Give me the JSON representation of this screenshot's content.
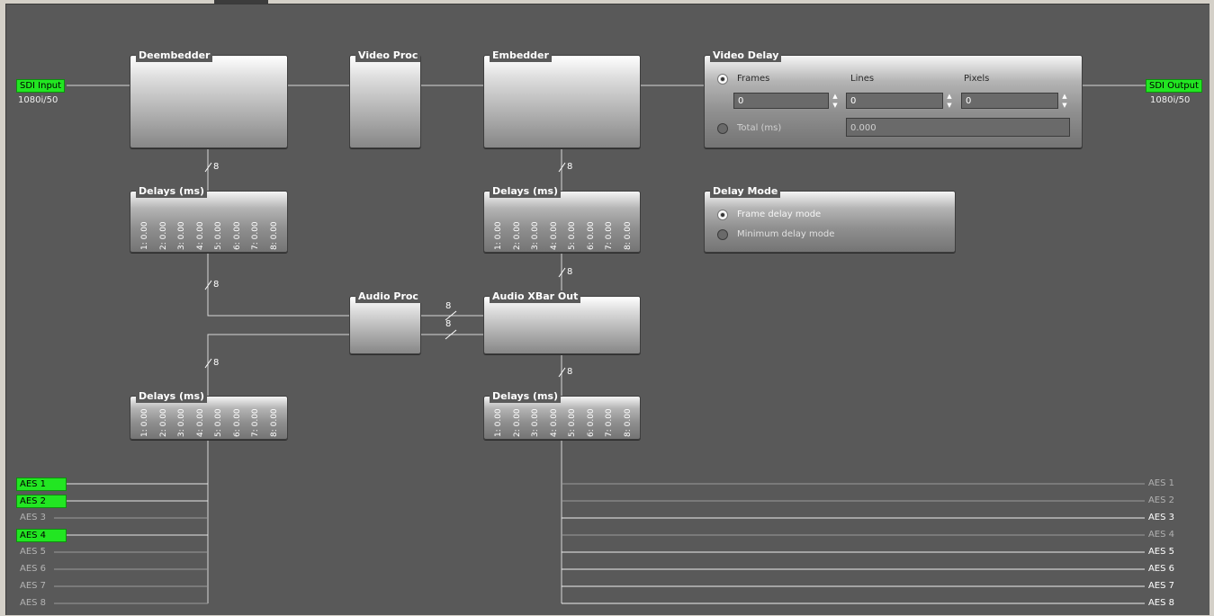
{
  "io": {
    "sdi_input_label": "SDI Input",
    "sdi_input_format": "1080i/50",
    "sdi_output_label": "SDI Output",
    "sdi_output_format": "1080i/50"
  },
  "blocks": {
    "deembedder": "Deembedder",
    "video_proc": "Video Proc",
    "embedder": "Embedder",
    "audio_proc": "Audio Proc",
    "audio_xbar_out": "Audio XBar Out"
  },
  "channel_count": "8",
  "delays": {
    "title": "Delays (ms)",
    "rows": [
      "1: 0.00",
      "2: 0.00",
      "3: 0.00",
      "4: 0.00",
      "5: 0.00",
      "6: 0.00",
      "7: 0.00",
      "8: 0.00"
    ]
  },
  "video_delay": {
    "title": "Video Delay",
    "frames_label": "Frames",
    "lines_label": "Lines",
    "pixels_label": "Pixels",
    "frames_value": "0",
    "lines_value": "0",
    "pixels_value": "0",
    "total_label": "Total (ms)",
    "total_value": "0.000",
    "selected": "frames"
  },
  "delay_mode": {
    "title": "Delay Mode",
    "option1": "Frame delay mode",
    "option2": "Minimum delay mode",
    "selected": "frame"
  },
  "aes_inputs": [
    {
      "label": "AES 1",
      "active": true
    },
    {
      "label": "AES 2",
      "active": true
    },
    {
      "label": "AES 3",
      "active": false
    },
    {
      "label": "AES 4",
      "active": true
    },
    {
      "label": "AES 5",
      "active": false
    },
    {
      "label": "AES 6",
      "active": false
    },
    {
      "label": "AES 7",
      "active": false
    },
    {
      "label": "AES 8",
      "active": false
    }
  ],
  "aes_outputs": [
    {
      "label": "AES 1",
      "active": false
    },
    {
      "label": "AES 2",
      "active": false
    },
    {
      "label": "AES 3",
      "active": true
    },
    {
      "label": "AES 4",
      "active": false
    },
    {
      "label": "AES 5",
      "active": true
    },
    {
      "label": "AES 6",
      "active": true
    },
    {
      "label": "AES 7",
      "active": true
    },
    {
      "label": "AES 8",
      "active": true
    }
  ],
  "colors": {
    "background": "#595959",
    "active_tag": "#22e622",
    "wire": "#d8d8d8"
  }
}
